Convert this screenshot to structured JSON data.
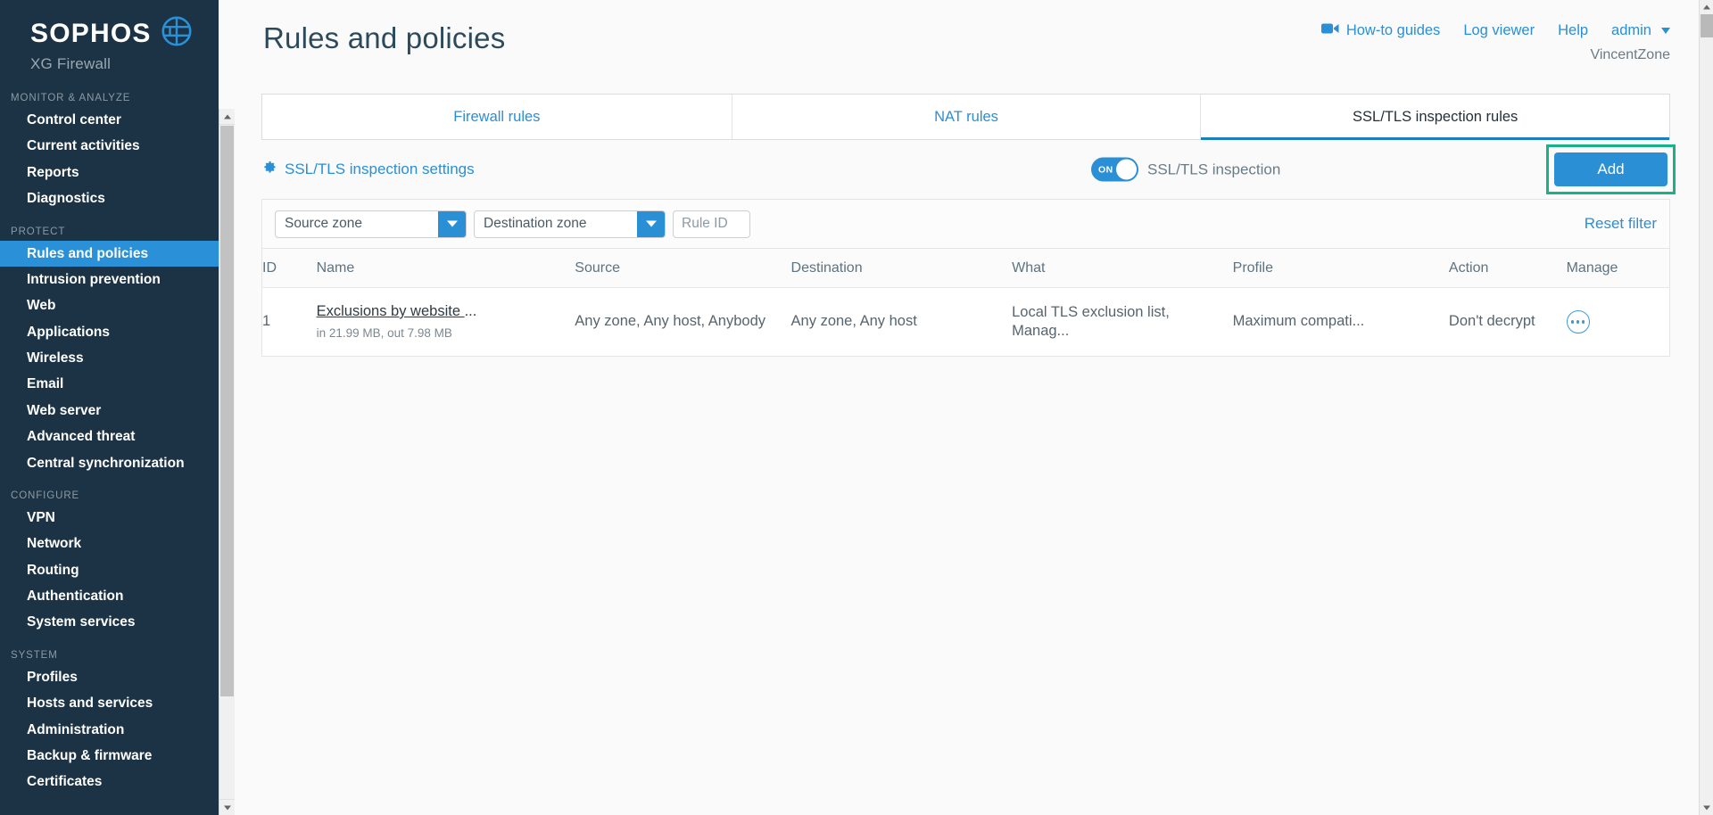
{
  "brand": {
    "name": "SOPHOS",
    "product": "XG Firewall",
    "logo_icon": "sophos-globe-icon"
  },
  "sidebar": {
    "sections": [
      {
        "label": "MONITOR & ANALYZE",
        "items": [
          {
            "label": "Control center",
            "active": false
          },
          {
            "label": "Current activities",
            "active": false
          },
          {
            "label": "Reports",
            "active": false
          },
          {
            "label": "Diagnostics",
            "active": false
          }
        ]
      },
      {
        "label": "PROTECT",
        "items": [
          {
            "label": "Rules and policies",
            "active": true
          },
          {
            "label": "Intrusion prevention",
            "active": false
          },
          {
            "label": "Web",
            "active": false
          },
          {
            "label": "Applications",
            "active": false
          },
          {
            "label": "Wireless",
            "active": false
          },
          {
            "label": "Email",
            "active": false
          },
          {
            "label": "Web server",
            "active": false
          },
          {
            "label": "Advanced threat",
            "active": false
          },
          {
            "label": "Central synchronization",
            "active": false
          }
        ]
      },
      {
        "label": "CONFIGURE",
        "items": [
          {
            "label": "VPN",
            "active": false
          },
          {
            "label": "Network",
            "active": false
          },
          {
            "label": "Routing",
            "active": false
          },
          {
            "label": "Authentication",
            "active": false
          },
          {
            "label": "System services",
            "active": false
          }
        ]
      },
      {
        "label": "SYSTEM",
        "items": [
          {
            "label": "Profiles",
            "active": false
          },
          {
            "label": "Hosts and services",
            "active": false
          },
          {
            "label": "Administration",
            "active": false
          },
          {
            "label": "Backup & firmware",
            "active": false
          },
          {
            "label": "Certificates",
            "active": false
          }
        ]
      }
    ]
  },
  "header": {
    "title": "Rules and policies",
    "how_to_guides": "How-to guides",
    "how_to_guides_icon": "video-camera-icon",
    "log_viewer": "Log viewer",
    "help": "Help",
    "admin": "admin",
    "admin_caret_icon": "chevron-down-icon",
    "zone": "VincentZone"
  },
  "tabs": [
    {
      "label": "Firewall rules",
      "active": false
    },
    {
      "label": "NAT rules",
      "active": false
    },
    {
      "label": "SSL/TLS inspection rules",
      "active": true
    }
  ],
  "settings": {
    "link_label": "SSL/TLS inspection settings",
    "link_icon": "gear-icon",
    "toggle_state": "ON",
    "toggle_label": "SSL/TLS inspection",
    "add_label": "Add",
    "add_highlight_color": "#17b386"
  },
  "filter": {
    "source_zone": "Source zone",
    "destination_zone": "Destination zone",
    "rule_id_placeholder": "Rule ID",
    "rule_id_value": "",
    "reset_label": "Reset filter"
  },
  "table": {
    "columns": [
      "ID",
      "Name",
      "Source",
      "Destination",
      "What",
      "Profile",
      "Action",
      "Manage"
    ],
    "rows": [
      {
        "id": "1",
        "name": "Exclusions by website ",
        "name_ellipsis": "...",
        "bytes": "in 21.99 MB, out 7.98 MB",
        "source": "Any zone, Any host, Anybody",
        "destination": "Any zone, Any host",
        "what": "Local TLS exclusion list, Manag...",
        "profile": "Maximum compati...",
        "action": "Don't decrypt",
        "manage_icon": "ellipsis-circle-icon"
      }
    ]
  },
  "colors": {
    "sidebar_bg": "#1b3344",
    "accent_blue": "#2a8fd4",
    "active_nav": "#2a91d8",
    "highlight_green": "#17b386",
    "title_text": "#2d4a5c"
  }
}
